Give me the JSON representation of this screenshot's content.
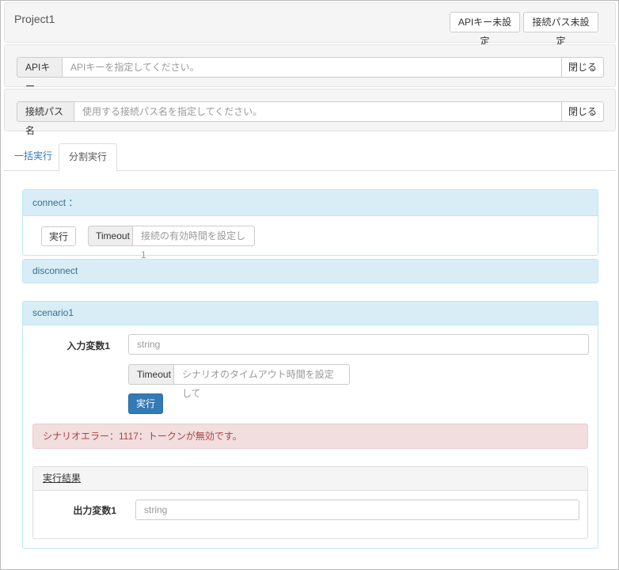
{
  "header": {
    "project_title": "Project1",
    "api_key_status_button": "APIキー未設定",
    "connection_path_status_button": "接続パス未設定"
  },
  "api_key_section": {
    "label": "APIキー",
    "placeholder": "APIキーを指定してください。",
    "close_label": "閉じる"
  },
  "connection_path_section": {
    "label": "接続パス名",
    "placeholder": "使用する接続パス名を指定してください。",
    "close_label": "閉じる"
  },
  "tabs": [
    {
      "label": "一括実行",
      "active": false
    },
    {
      "label": "分割実行",
      "active": true
    }
  ],
  "connect_panel": {
    "title": "connect ：",
    "run_label": "実行",
    "timeout_label": "Timeout",
    "timeout_placeholder": "接続の有効時間を設定し1"
  },
  "disconnect_panel": {
    "title": "disconnect"
  },
  "scenario_panel": {
    "title": "scenario1",
    "input_variable_label": "入力変数1",
    "input_variable_placeholder": "string",
    "timeout_label": "Timeout",
    "timeout_placeholder": "シナリオのタイムアウト時間を設定して",
    "run_label": "実行",
    "error_message": "シナリオエラー：1117：トークンが無効です。",
    "result": {
      "title": "実行結果",
      "output_variable_label": "出力変数1",
      "output_variable_placeholder": "string"
    }
  },
  "colors": {
    "primary": "#337ab7",
    "panel_heading_bg": "#d9edf7",
    "panel_heading_text": "#31708f",
    "error_bg": "#f2dede",
    "error_text": "#a94442"
  }
}
